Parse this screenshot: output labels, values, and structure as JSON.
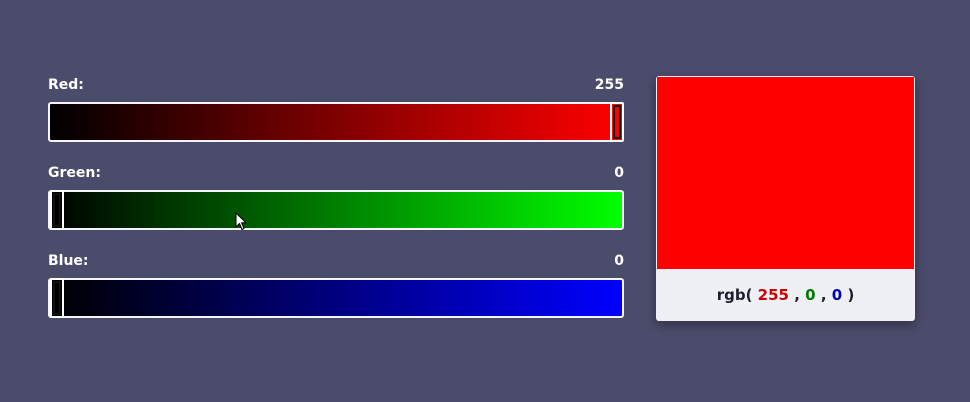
{
  "sliders": [
    {
      "label": "Red:",
      "value": "255",
      "level": 1.0,
      "channel": "red",
      "gradient_end": "#ff0000"
    },
    {
      "label": "Green:",
      "value": "0",
      "level": 0.0,
      "channel": "green",
      "gradient_end": "#00ff00"
    },
    {
      "label": "Blue:",
      "value": "0",
      "level": 0.0,
      "channel": "blue",
      "gradient_end": "#0000ff"
    }
  ],
  "preview": {
    "swatch_color": "#ff0000",
    "prefix": "rgb(",
    "red": "255",
    "sep1": ",",
    "green": "0",
    "sep2": ",",
    "blue": "0",
    "suffix": ")",
    "red_color": "#cc0000",
    "green_color": "#007a00",
    "blue_color": "#0000b0"
  },
  "colors": {
    "background": "#4b4b6b",
    "gradient_start": "#000000"
  },
  "cursor_icon": "mouse-pointer-icon"
}
